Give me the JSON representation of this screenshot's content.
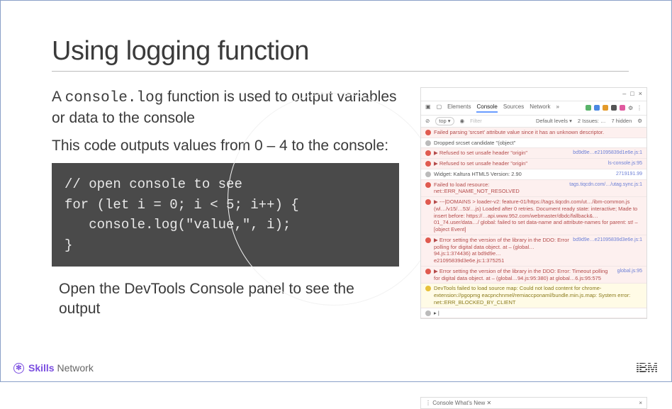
{
  "title": "Using logging function",
  "para1_pre": "A ",
  "para1_code": "console.log",
  "para1_post": " function is used to output variables or data to the console",
  "para2": "This code outputs values from 0 – 4 to the console:",
  "code": "// open console to see\nfor (let i = 0; i < 5; i++) {\n   console.log(\"value,\", i);\n}",
  "para3": "Open the DevTools Console panel to see the output",
  "footer": {
    "skills_bold": "Skills",
    "skills_rest": "Network",
    "ibm": "IBM"
  },
  "devtools": {
    "window_controls": [
      "–",
      "□",
      "×"
    ],
    "tabs": [
      "Elements",
      "Console",
      "Sources",
      "Network"
    ],
    "active_tab": "Console",
    "ext_dots": 6,
    "sub": {
      "top": "top ▾",
      "eye": "◉",
      "filter": "Filter",
      "levels": "Default levels ▾",
      "issues": "2 Issues: …",
      "hidden": "7 hidden"
    },
    "messages": [
      {
        "kind": "err",
        "icon": "red",
        "text": "Failed parsing 'srcset' attribute value since it has an unknown descriptor.",
        "link": ""
      },
      {
        "kind": "info",
        "icon": "grey",
        "text": "Dropped srcset candidate \"(object\"",
        "link": ""
      },
      {
        "kind": "err",
        "icon": "red",
        "text": "▶ Refused to set unsafe header \"origin\"",
        "link": "bd9d9e…e21095839d1e6e.js:1"
      },
      {
        "kind": "err",
        "icon": "red",
        "text": "▶ Refused to set unsafe header \"origin\"",
        "link": "ls-console.js:95"
      },
      {
        "kind": "info",
        "icon": "grey",
        "text": "Widget: Kaltura HTML5 Version: 2.90",
        "link": "2719191.99"
      },
      {
        "kind": "err",
        "icon": "red",
        "text": "Failed to load resource: net::ERR_NAME_NOT_RESOLVED",
        "link": "tags.tiqcdn.com/…/utag.sync.js:1"
      },
      {
        "kind": "err",
        "icon": "red",
        "text": "▶ ---|DOMAINS > loader-v2: feature-01/https://tags.tiqcdn.com/ut…/ibm-common.js (wl…/v15/…53/…js) Loaded after 0 retries. Document ready state: interactive; Made to insert before: https://…api.www.952.com/webmaster/dbdc/fallback&…01_74.user/data…/ global: failed to set data-name and attribute-names for parent: st! – [object Event]",
        "link": ""
      },
      {
        "kind": "err",
        "icon": "red",
        "text": "▶ Error setting the version of the library in the DDO: Error polling for digital data object. at – (global…94.js:1:374436) at bd9d9e…e21095839d3e6e.js:1:375251",
        "link": "bd9d9e…e21095839d3e6e.js:1"
      },
      {
        "kind": "err",
        "icon": "red",
        "text": "▶ Error setting the version of the library in the DDO: Error: Timeout polling for digital data object. at – (global…94.js:95:380) at global…6.js:95:575",
        "link": "global.js:95"
      },
      {
        "kind": "warn",
        "icon": "yel",
        "text": "DevTools failed to load source map: Could not load content for chrome-extension://pgopmg eacpnchnmel/remiaccponaml/bundle.min.js.map: System error: net::ERR_BLOCKED_BY_CLIENT",
        "link": ""
      },
      {
        "kind": "info",
        "icon": "grey",
        "text": "▸ |",
        "link": ""
      }
    ],
    "bottom": {
      "left": "⋮  Console   What's New ✕",
      "right": "×"
    }
  }
}
